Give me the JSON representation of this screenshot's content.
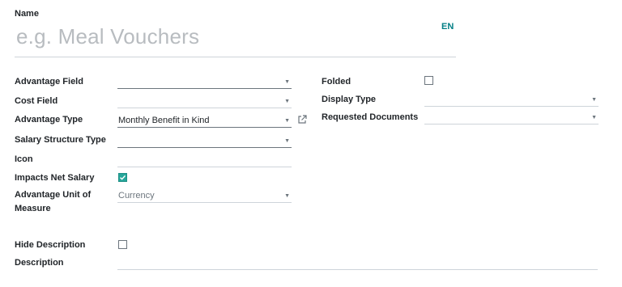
{
  "name": {
    "label": "Name",
    "placeholder": "e.g. Meal Vouchers",
    "language": "EN"
  },
  "fields": {
    "advantage_field": {
      "label": "Advantage Field",
      "value": ""
    },
    "cost_field": {
      "label": "Cost Field",
      "value": ""
    },
    "advantage_type": {
      "label": "Advantage Type",
      "value": "Monthly Benefit in Kind"
    },
    "salary_structure_type": {
      "label": "Salary Structure Type",
      "value": ""
    },
    "icon": {
      "label": "Icon",
      "value": ""
    },
    "impacts_net_salary": {
      "label": "Impacts Net Salary",
      "checked": true
    },
    "unit_of_measure": {
      "label_line1": "Advantage Unit of",
      "label_line2": "Measure",
      "value": "Currency"
    },
    "hide_description": {
      "label": "Hide Description",
      "checked": false
    },
    "description": {
      "label": "Description",
      "value": ""
    },
    "folded": {
      "label": "Folded",
      "checked": false
    },
    "display_type": {
      "label": "Display Type",
      "value": ""
    },
    "requested_documents": {
      "label": "Requested Documents",
      "value": ""
    }
  },
  "icons": {
    "dropdown": "caret-down-icon",
    "external": "external-link-icon",
    "check": "checkmark-icon"
  },
  "colors": {
    "accent": "#017e84",
    "checkbox_on": "#26a69a",
    "placeholder": "#b8bcc0"
  }
}
